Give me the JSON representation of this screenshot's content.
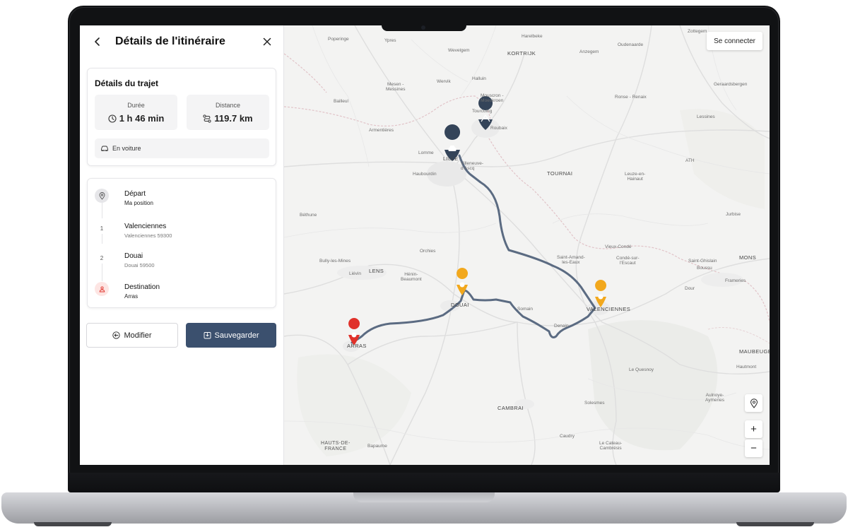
{
  "panel": {
    "title": "Détails de l'itinéraire",
    "trip": {
      "heading": "Détails du trajet",
      "duration_label": "Durée",
      "duration_value": "1 h 46 min",
      "distance_label": "Distance",
      "distance_value": "119.7 km",
      "mode": "En voiture"
    },
    "steps": [
      {
        "marker": "",
        "label": "Départ",
        "sub": "Ma position"
      },
      {
        "marker": "1",
        "label": "Valenciennes",
        "sub": "Valenciennes 59300"
      },
      {
        "marker": "2",
        "label": "Douai",
        "sub": "Douai 59500"
      },
      {
        "marker": "",
        "label": "Destination",
        "sub": "Arras"
      }
    ],
    "buttons": {
      "modify": "Modifier",
      "save": "Sauvegarder"
    }
  },
  "map": {
    "connect_label": "Se connecter",
    "zoom_in": "+",
    "zoom_out": "−",
    "route_color": "#5b6b82",
    "start_color": "#344459",
    "waypoint_color": "#f2a81d",
    "destination_color": "#e0312a",
    "labels": {
      "poperinge": "Poperinge",
      "ypres": "Ypres",
      "wevelgem": "Wevelgem",
      "harelbeke": "Harelbeke",
      "kortrijk": "KORTRIJK",
      "anzegem": "Anzegem",
      "oudenaarde": "Oudenaarde",
      "zottegem": "Zottegem",
      "geraardsbergen": "Geraardsbergen",
      "halluin": "Halluin",
      "wervik": "Wervik",
      "mesen": "Mesen -\nMessines",
      "bailleul": "Bailleul",
      "mouscron": "Mouscron -\nMoeskroen",
      "ronse": "Ronse - Renaix",
      "tourcoing": "Tourcoing",
      "roubaix": "Roubaix",
      "armentieres": "Armentières",
      "lessines": "Lessines",
      "lomme": "Lomme",
      "lille": "LILLE",
      "villeneuve": "Villeneuve-\nd'Ascq",
      "haubourdin": "Haubourdin",
      "tournai": "TOURNAI",
      "leuze": "Leuze-en-\nHainaut",
      "ath": "ATH",
      "bethune": "Béthune",
      "jurbise": "Jurbise",
      "orchies": "Orchies",
      "saint_amand": "Saint-Amand-\nles-Eaux",
      "vieux_conde": "Vieux-Condé",
      "conde": "Condé-sur-\nl'Escaut",
      "saint_ghislain": "Saint-Ghislain",
      "boussu": "Boussu",
      "mons": "MONS",
      "bully": "Bully-les-Mines",
      "lievin": "Liévin",
      "lens": "LENS",
      "henin": "Hénin-\nBeaumont",
      "dour": "Dour",
      "frameries": "Frameries",
      "douai": "DOUAI",
      "somain": "Somain",
      "valenciennes": "VALENCIENNES",
      "denain": "Denain",
      "arras": "ARRAS",
      "maubeuge": "MAUBEUGE",
      "hautmont": "Hautmont",
      "le_quesnoy": "Le Quesnoy",
      "aulnoye": "Aulnoye-\nAymeries",
      "cambrai": "CAMBRAI",
      "solesmes": "Solesmes",
      "caudry": "Caudry",
      "le_cateau": "Le Cateau-\nCambrésis",
      "bapaume": "Bapaume",
      "hauts_de_france": "HAUTS-DE-\nFRANCE"
    }
  }
}
